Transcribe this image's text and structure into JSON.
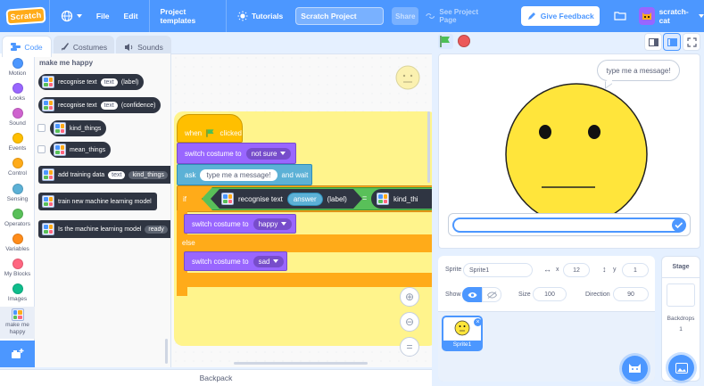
{
  "menubar": {
    "logo_text": "Scratch",
    "file": "File",
    "edit": "Edit",
    "project_templates": "Project templates",
    "tutorials": "Tutorials",
    "project_title": "Scratch Project",
    "share": "Share",
    "see_project_page": "See Project Page",
    "give_feedback": "Give Feedback",
    "username": "scratch-cat"
  },
  "tabs": {
    "code": "Code",
    "costumes": "Costumes",
    "sounds": "Sounds"
  },
  "categories": [
    {
      "label": "Motion",
      "color": "#4c97ff"
    },
    {
      "label": "Looks",
      "color": "#9966ff"
    },
    {
      "label": "Sound",
      "color": "#cf63cf"
    },
    {
      "label": "Events",
      "color": "#ffbf00"
    },
    {
      "label": "Control",
      "color": "#ffab19"
    },
    {
      "label": "Sensing",
      "color": "#5cb1d6"
    },
    {
      "label": "Operators",
      "color": "#59c059"
    },
    {
      "label": "Variables",
      "color": "#ff8c1a"
    },
    {
      "label": "My Blocks",
      "color": "#ff6680"
    },
    {
      "label": "Images",
      "color": "#0fbd8c"
    },
    {
      "label": "make me happy",
      "color": "#2f3542"
    }
  ],
  "palette": {
    "title": "make me happy",
    "blocks": {
      "recognise_text": "recognise text",
      "text_arg": "text",
      "label_arg": "(label)",
      "confidence_arg": "(confidence)",
      "kind_things": "kind_things",
      "mean_things": "mean_things",
      "add_training_data": "add training data",
      "kind_things_dropdown": "kind_things",
      "train_model": "train new machine learning model",
      "is_model": "Is the machine learning model",
      "ready_arg": "ready"
    }
  },
  "script": {
    "when": "when",
    "clicked": "clicked",
    "switch_costume_to": "switch costume to",
    "costume_not_sure": "not sure",
    "ask": "ask",
    "ask_message": "type me a message!",
    "and_wait": "and wait",
    "if": "if",
    "recognise_text": "recognise text",
    "answer": "answer",
    "label": "(label)",
    "equals": "=",
    "kind_things": "kind_thi",
    "costume_happy": "happy",
    "else": "else",
    "costume_sad": "sad"
  },
  "backpack": "Backpack",
  "stage": {
    "speech_bubble": "type me a message!"
  },
  "sprite_info": {
    "sprite_label": "Sprite",
    "sprite_name": "Sprite1",
    "x_label": "x",
    "x_value": "12",
    "y_label": "y",
    "y_value": "1",
    "show_label": "Show",
    "size_label": "Size",
    "size_value": "100",
    "direction_label": "Direction",
    "direction_value": "90"
  },
  "sprite_list": [
    {
      "name": "Sprite1"
    }
  ],
  "stage_pane": {
    "title": "Stage",
    "backdrops_label": "Backdrops",
    "backdrops_count": "1"
  },
  "colors": {
    "accent": "#4c97ff",
    "looks": "#9966ff",
    "control": "#ffab19",
    "events": "#ffbf00",
    "extension": "#2f3542"
  }
}
